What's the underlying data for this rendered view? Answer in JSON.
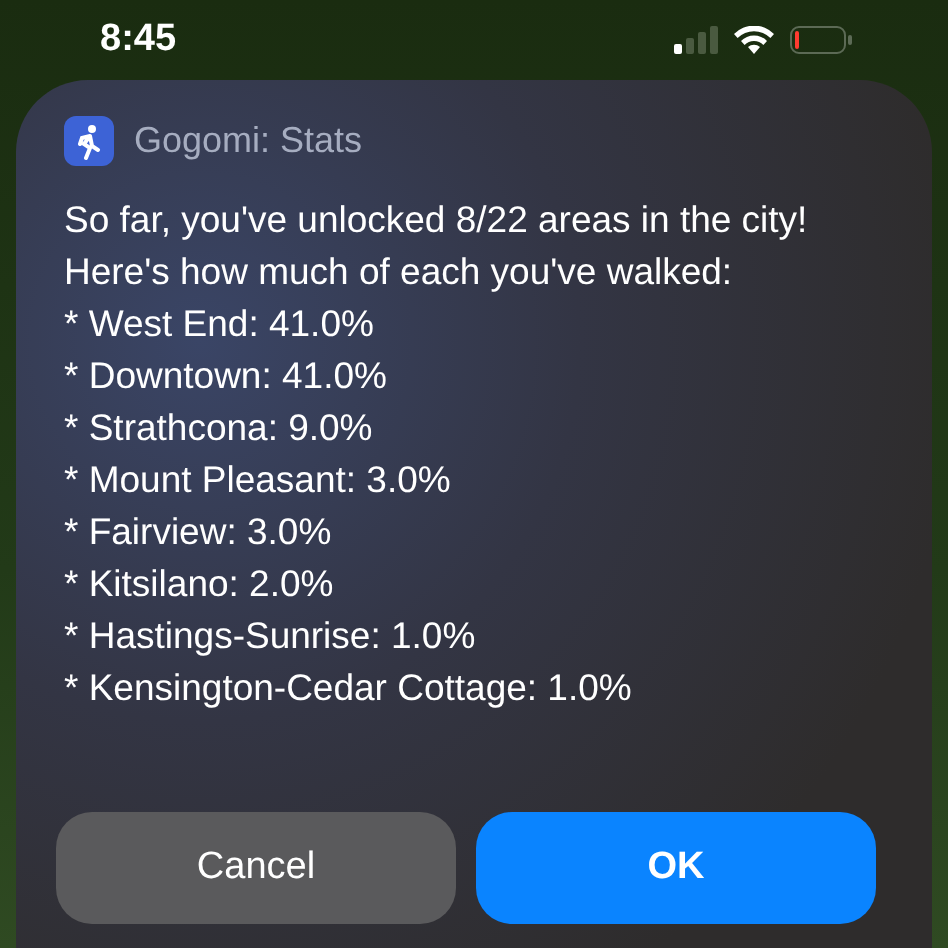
{
  "status_bar": {
    "time": "8:45"
  },
  "alert": {
    "app_name": "Gogomi: Stats",
    "message": "So far, you've unlocked 8/22 areas in the city! Here's how much of each you've walked:",
    "lines": [
      "* West End: 41.0%",
      "* Downtown: 41.0%",
      "* Strathcona: 9.0%",
      "* Mount Pleasant: 3.0%",
      "* Fairview: 3.0%",
      "* Kitsilano: 2.0%",
      "* Hastings-Sunrise: 1.0%",
      "* Kensington-Cedar Cottage: 1.0%"
    ],
    "buttons": [
      {
        "label": "Cancel",
        "kind": "secondary"
      },
      {
        "label": "OK",
        "kind": "primary"
      }
    ]
  }
}
